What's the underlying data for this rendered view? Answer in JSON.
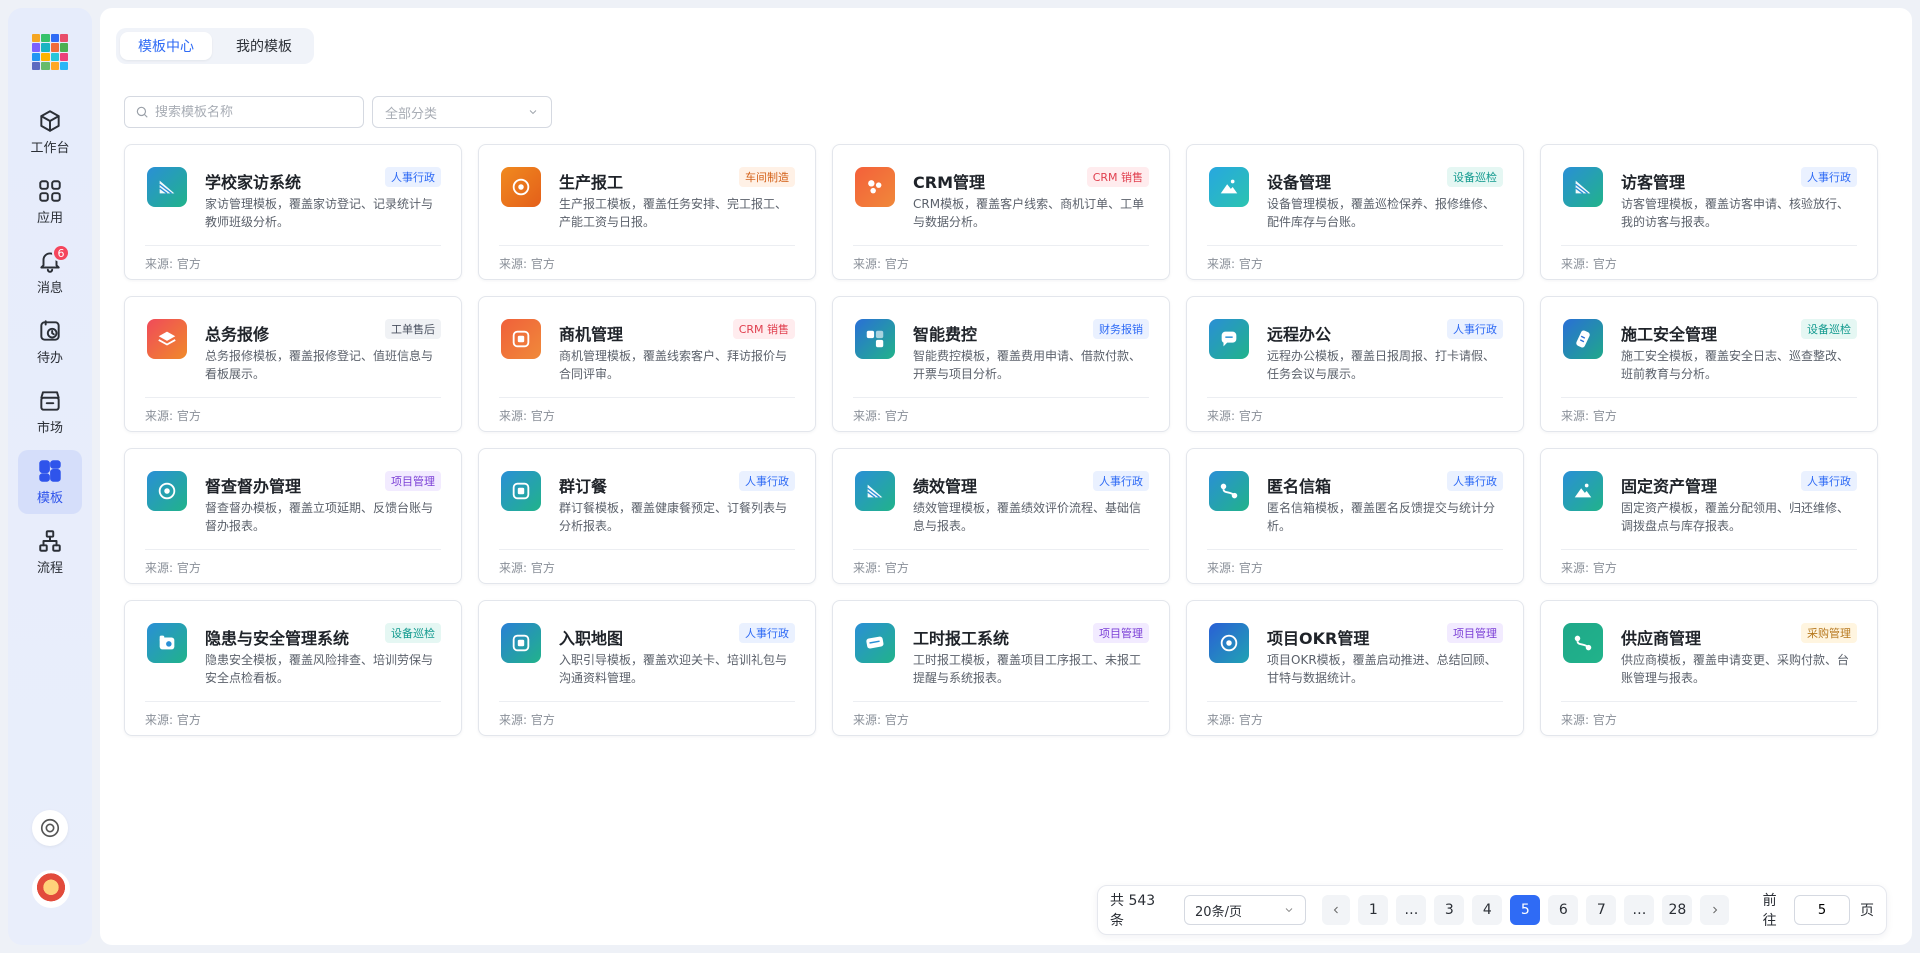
{
  "sidebar": {
    "logo_colors": [
      "#f5a623",
      "#36c26b",
      "#2f6bf5",
      "#e84e6a",
      "#7b61ff",
      "#19b4c2",
      "#f06b3a",
      "#4caf50",
      "#2196f3",
      "#ffb300",
      "#26c6da",
      "#ec407a",
      "#5c6bc0",
      "#66bb6a",
      "#ffa726",
      "#29b6f6"
    ],
    "items": [
      {
        "label": "工作台",
        "icon": "cube-icon"
      },
      {
        "label": "应用",
        "icon": "apps-icon"
      },
      {
        "label": "消息",
        "icon": "bell-icon",
        "badge": "6"
      },
      {
        "label": "待办",
        "icon": "todo-icon"
      },
      {
        "label": "市场",
        "icon": "market-icon"
      },
      {
        "label": "模板",
        "icon": "template-icon"
      },
      {
        "label": "流程",
        "icon": "flow-icon"
      }
    ]
  },
  "tabs": [
    {
      "label": "模板中心"
    },
    {
      "label": "我的模板"
    }
  ],
  "search": {
    "placeholder": "搜索模板名称"
  },
  "category": {
    "value": "全部分类"
  },
  "cards": [
    {
      "name": "学校家访系统",
      "tag": "人事行政",
      "desc": "家访管理模板，覆盖家访登记、记录统计与教师班级分析。",
      "source": "来源: 官方",
      "icon": "chart-icon",
      "grad": [
        "#2a8fd6",
        "#21b38a"
      ],
      "tag_color": "#2f6bf5",
      "tag_bg": "#eaf1ff"
    },
    {
      "name": "生产报工",
      "tag": "车间制造",
      "desc": "生产报工模板，覆盖任务安排、完工报工、产能工资与日报。",
      "source": "来源: 官方",
      "icon": "target-icon",
      "grad": [
        "#f08a1f",
        "#e45f1a"
      ],
      "tag_color": "#d4621a",
      "tag_bg": "#fff1e6"
    },
    {
      "name": "CRM管理",
      "tag": "CRM 销售",
      "desc": "CRM模板，覆盖客户线索、商机订单、工单与数据分析。",
      "source": "来源: 官方",
      "icon": "dots-icon",
      "grad": [
        "#f4603a",
        "#f0883a"
      ],
      "tag_color": "#e0404f",
      "tag_bg": "#ffecee"
    },
    {
      "name": "设备管理",
      "tag": "设备巡检",
      "desc": "设备管理模板，覆盖巡检保养、报修维修、配件库存与台账。",
      "source": "来源: 官方",
      "icon": "mountain-icon",
      "grad": [
        "#27a7e0",
        "#2bc4b0"
      ],
      "tag_color": "#11998e",
      "tag_bg": "#e5f7f3"
    },
    {
      "name": "访客管理",
      "tag": "人事行政",
      "desc": "访客管理模板，覆盖访客申请、核验放行、我的访客与报表。",
      "source": "来源: 官方",
      "icon": "chart-icon",
      "grad": [
        "#2a8fd6",
        "#21b38a"
      ],
      "tag_color": "#2f6bf5",
      "tag_bg": "#eaf1ff"
    },
    {
      "name": "总务报修",
      "tag": "工单售后",
      "desc": "总务报修模板，覆盖报修登记、值班信息与看板展示。",
      "source": "来源: 官方",
      "icon": "layers-icon",
      "grad": [
        "#f04a5a",
        "#f08a2a"
      ],
      "tag_color": "#4a5160",
      "tag_bg": "#f0f2f5"
    },
    {
      "name": "商机管理",
      "tag": "CRM 销售",
      "desc": "商机管理模板，覆盖线索客户、拜访报价与合同评审。",
      "source": "来源: 官方",
      "icon": "square-icon",
      "grad": [
        "#f0603a",
        "#f08a3a"
      ],
      "tag_color": "#e0404f",
      "tag_bg": "#ffecee"
    },
    {
      "name": "智能费控",
      "tag": "财务报销",
      "desc": "智能费控模板，覆盖费用申请、借款付款、开票与项目分析。",
      "source": "来源: 官方",
      "icon": "blocks-icon",
      "grad": [
        "#2a6fd6",
        "#21b38a"
      ],
      "tag_color": "#2f6bf5",
      "tag_bg": "#eaf1ff"
    },
    {
      "name": "远程办公",
      "tag": "人事行政",
      "desc": "远程办公模板，覆盖日报周报、打卡请假、任务会议与展示。",
      "source": "来源: 官方",
      "icon": "chat-icon",
      "grad": [
        "#2a8fd6",
        "#21b38a"
      ],
      "tag_color": "#2f6bf5",
      "tag_bg": "#eaf1ff"
    },
    {
      "name": "施工安全管理",
      "tag": "设备巡检",
      "desc": "施工安全模板，覆盖安全日志、巡查整改、班前教育与分析。",
      "source": "来源: 官方",
      "icon": "badge-icon",
      "grad": [
        "#2a6fd6",
        "#1fa88a"
      ],
      "tag_color": "#11998e",
      "tag_bg": "#e5f7f3"
    },
    {
      "name": "督查督办管理",
      "tag": "项目管理",
      "desc": "督查督办模板，覆盖立项延期、反馈台账与督办报表。",
      "source": "来源: 官方",
      "icon": "target-icon",
      "grad": [
        "#2a8fd6",
        "#21b38a"
      ],
      "tag_color": "#7b3fd6",
      "tag_bg": "#f2ebff"
    },
    {
      "name": "群订餐",
      "tag": "人事行政",
      "desc": "群订餐模板，覆盖健康餐预定、订餐列表与分析报表。",
      "source": "来源: 官方",
      "icon": "square-icon",
      "grad": [
        "#2a8fd6",
        "#21b38a"
      ],
      "tag_color": "#2f6bf5",
      "tag_bg": "#eaf1ff"
    },
    {
      "name": "绩效管理",
      "tag": "人事行政",
      "desc": "绩效管理模板，覆盖绩效评价流程、基础信息与报表。",
      "source": "来源: 官方",
      "icon": "chart-icon",
      "grad": [
        "#2a8fd6",
        "#21b38a"
      ],
      "tag_color": "#2f6bf5",
      "tag_bg": "#eaf1ff"
    },
    {
      "name": "匿名信箱",
      "tag": "人事行政",
      "desc": "匿名信箱模板，覆盖匿名反馈提交与统计分析。",
      "source": "来源: 官方",
      "icon": "nodes-icon",
      "grad": [
        "#2a8fd6",
        "#21b38a"
      ],
      "tag_color": "#2f6bf5",
      "tag_bg": "#eaf1ff"
    },
    {
      "name": "固定资产管理",
      "tag": "人事行政",
      "desc": "固定资产模板，覆盖分配领用、归还维修、调拨盘点与库存报表。",
      "source": "来源: 官方",
      "icon": "mountain-icon",
      "grad": [
        "#2a8fd6",
        "#21b38a"
      ],
      "tag_color": "#2f6bf5",
      "tag_bg": "#eaf1ff"
    },
    {
      "name": "隐患与安全管理系统",
      "tag": "设备巡检",
      "desc": "隐患安全模板，覆盖风险排查、培训劳保与安全点检看板。",
      "source": "来源: 官方",
      "icon": "camera-icon",
      "grad": [
        "#2a8fd6",
        "#21b38a"
      ],
      "tag_color": "#11998e",
      "tag_bg": "#e5f7f3"
    },
    {
      "name": "入职地图",
      "tag": "人事行政",
      "desc": "入职引导模板，覆盖欢迎关卡、培训礼包与沟通资料管理。",
      "source": "来源: 官方",
      "icon": "square-icon",
      "grad": [
        "#2a7fd6",
        "#21b38a"
      ],
      "tag_color": "#2f6bf5",
      "tag_bg": "#eaf1ff"
    },
    {
      "name": "工时报工系统",
      "tag": "项目管理",
      "desc": "工时报工模板，覆盖项目工序报工、未报工提醒与系统报表。",
      "source": "来源: 官方",
      "icon": "card-icon",
      "grad": [
        "#2a8fd6",
        "#21b38a"
      ],
      "tag_color": "#7b3fd6",
      "tag_bg": "#f2ebff"
    },
    {
      "name": "项目OKR管理",
      "tag": "项目管理",
      "desc": "项目OKR模板，覆盖启动推进、总结回顾、甘特与数据统计。",
      "source": "来源: 官方",
      "icon": "target-icon",
      "grad": [
        "#2a5fd6",
        "#21a3b3"
      ],
      "tag_color": "#7b3fd6",
      "tag_bg": "#f2ebff"
    },
    {
      "name": "供应商管理",
      "tag": "采购管理",
      "desc": "供应商模板，覆盖申请变更、采购付款、台账管理与报表。",
      "source": "来源: 官方",
      "icon": "nodes-icon",
      "grad": [
        "#1fa88a",
        "#21b38a"
      ],
      "tag_color": "#b7791f",
      "tag_bg": "#fff5e0"
    }
  ],
  "pagination": {
    "total": "共 543 条",
    "page_size": "20条/页",
    "pages": [
      "1",
      "…",
      "3",
      "4",
      "5",
      "6",
      "7",
      "…",
      "28"
    ],
    "current": "5",
    "goto_label": "前往",
    "goto_value": "5",
    "page_unit": "页"
  }
}
